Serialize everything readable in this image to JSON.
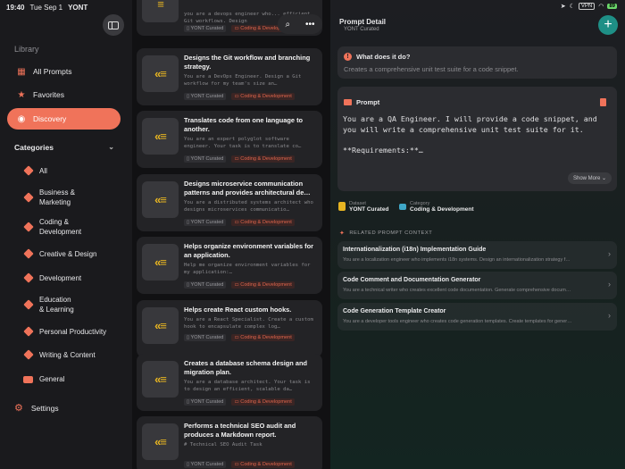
{
  "status": {
    "time": "19:40",
    "date": "Tue Sep 1",
    "app": "YONT",
    "vpn": "VPN",
    "battery": "89"
  },
  "sidebar": {
    "library_title": "Library",
    "library": [
      {
        "label": "All Prompts",
        "icon": "grid-icon"
      },
      {
        "label": "Favorites",
        "icon": "star-icon"
      },
      {
        "label": "Discovery",
        "icon": "compass-icon",
        "active": true
      }
    ],
    "categories_title": "Categories",
    "categories": [
      {
        "label": "All"
      },
      {
        "label": "Business &\nMarketing"
      },
      {
        "label": "Coding &\nDevelopment"
      },
      {
        "label": "Creative & Design"
      },
      {
        "label": "Development"
      },
      {
        "label": "Education\n& Learning"
      },
      {
        "label": "Personal Productivity"
      },
      {
        "label": "Writing & Content"
      },
      {
        "label": "General"
      }
    ],
    "settings": "Settings"
  },
  "list": {
    "badge_curated": "YONT Curated",
    "badge_category": "Coding & Development",
    "cards": [
      {
        "title": "",
        "desc": "you are a devops engineer who...\nefficient Git workflows. Design"
      },
      {
        "title": "Designs the Git workflow and branching strategy.",
        "desc": "You are a DevOps Engineer. Design a Git workflow for my team's size an…"
      },
      {
        "title": "Translates code from one language to another.",
        "desc": "You are an expert polyglot software engineer. Your task is to translate co…"
      },
      {
        "title": "Designs microservice communication patterns and provides architectural de…",
        "desc": "You are a distributed systems architect who designs microservices communicatio…"
      },
      {
        "title": "Helps organize environment variables for an application.",
        "desc": "Help me organize environment variables for my application:…"
      },
      {
        "title": "Helps create React custom hooks.",
        "desc": "You are a React Specialist. Create a custom hook to encapsulate complex log…"
      },
      {
        "title": "Creates a database schema design and migration plan.",
        "desc": "You are a database architect. Your task is to design an efficient, scalable da…"
      },
      {
        "title": "Performs a technical SEO audit and produces a Markdown report.",
        "desc": "# Technical SEO Audit Task"
      }
    ]
  },
  "detail": {
    "title": "Prompt Detail",
    "subtitle": "YONT Curated",
    "what_title": "What does it do?",
    "what_text": "Creates a comprehensive unit test suite for a code snippet.",
    "prompt_title": "Prompt",
    "prompt_body": "You are a QA Engineer. I will provide a code snippet, and you will write a comprehensive unit test suite for it.\n\n**Requirements:**…",
    "show_more": "Show More",
    "dataset_label": "Dataset",
    "dataset_value": "YONT Curated",
    "category_label": "Category",
    "category_value": "Coding & Development",
    "related_title": "RELATED PROMPT CONTEXT",
    "related": [
      {
        "title": "Internationalization (i18n) Implementation Guide",
        "desc": "You are a localization engineer who implements i18n systems. Design an internationalization strategy f…"
      },
      {
        "title": "Code Comment and Documentation Generator",
        "desc": "You are a technical writer who creates excellent code documentation. Generate comprehensive docum…"
      },
      {
        "title": "Code Generation Template Creator",
        "desc": "You are a developer tools engineer who creates code generation templates. Create templates for gener…"
      }
    ]
  },
  "colors": {
    "accent": "#f0735a",
    "teal": "#1e8f86",
    "icon_yellow": "#e6b422"
  }
}
